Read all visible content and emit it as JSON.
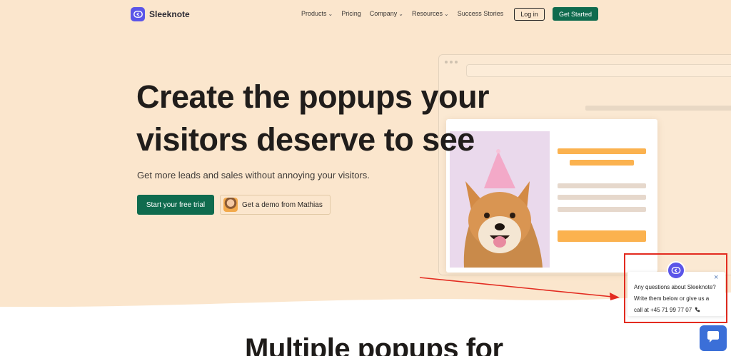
{
  "nav": {
    "brand": "Sleeknote",
    "links": [
      {
        "label": "Products",
        "has_dropdown": true
      },
      {
        "label": "Pricing",
        "has_dropdown": false
      },
      {
        "label": "Company",
        "has_dropdown": true
      },
      {
        "label": "Resources",
        "has_dropdown": true
      },
      {
        "label": "Success Stories",
        "has_dropdown": false
      }
    ],
    "login_label": "Log in",
    "get_started_label": "Get Started"
  },
  "hero": {
    "title_line1": "Create the popups your",
    "title_line2": "visitors deserve to see",
    "subtitle": "Get more leads and sales without annoying your visitors.",
    "trial_button": "Start your free trial",
    "demo_button": "Get a demo from Mathias"
  },
  "chat": {
    "message_line1": "Any questions about Sleeknote?",
    "message_line2": "Write them below or give us a",
    "message_line3": "call at +45 71 99 77 07",
    "close_icon": "×"
  },
  "lower": {
    "heading": "Multiple popups for"
  },
  "colors": {
    "background": "#fbe6cd",
    "brand_purple": "#5b55e8",
    "primary_green": "#0f6b4e",
    "accent_orange": "#fbb24f",
    "highlight_red": "#e32b20",
    "chat_blue": "#3b6fd8"
  },
  "icons": {
    "logo": "sleeknote-logo-icon",
    "dropdown": "chevron-down-icon",
    "phone": "phone-icon",
    "chat": "chat-bubble-icon",
    "close": "close-icon"
  }
}
